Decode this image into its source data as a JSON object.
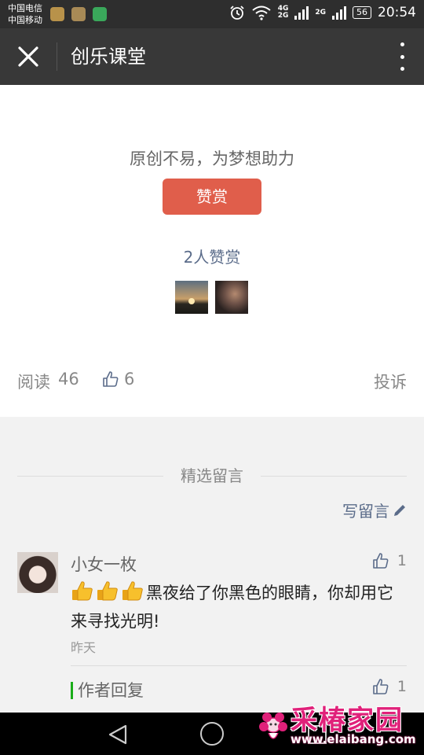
{
  "status_bar": {
    "carrier_1": "中国电信",
    "carrier_2": "中国移动",
    "network_1": "4G",
    "network_2": "2G",
    "network_3": "2G",
    "battery": "56",
    "time": "20:54"
  },
  "title_bar": {
    "title": "创乐课堂"
  },
  "reward": {
    "prompt": "原创不易，为梦想助力",
    "button_label": "赞赏",
    "count_text": "2人赞赏",
    "button_color": "#e05e4b"
  },
  "stats": {
    "read_label": "阅读",
    "read_count": "46",
    "like_count": "6",
    "report_label": "投诉"
  },
  "comments": {
    "section_title": "精选留言",
    "write_label": "写留言",
    "items": [
      {
        "author": "小女一枚",
        "likes": "1",
        "text": "黑夜给了你黑色的眼睛，你却用它来寻找光明!",
        "time": "昨天",
        "reply_label": "作者回复",
        "reply_likes": "1"
      }
    ]
  },
  "watermark": {
    "title": "采椿家园",
    "url": "www.elaibang.com"
  },
  "colors": {
    "accent_link": "#5b6c8a",
    "reply_marker": "#1aad19",
    "titlebar": "#383838"
  }
}
